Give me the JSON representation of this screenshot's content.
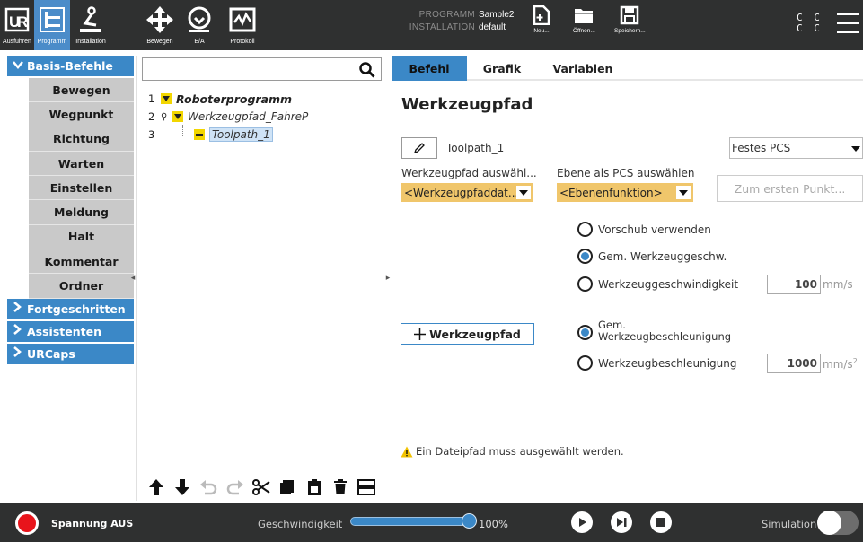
{
  "topbar": {
    "nav": [
      {
        "label": "Ausführen",
        "icon": "ur-logo-icon"
      },
      {
        "label": "Programm",
        "icon": "program-tree-icon",
        "active": true
      },
      {
        "label": "Installation",
        "icon": "installation-icon"
      },
      {
        "label": "Bewegen",
        "icon": "move-arrows-icon"
      },
      {
        "label": "E/A",
        "icon": "io-icon"
      },
      {
        "label": "Protokoll",
        "icon": "log-icon"
      }
    ],
    "program_key": "PROGRAMM",
    "program_value": "Sample2",
    "installation_key": "INSTALLATION",
    "installation_value": "default",
    "file_buttons": [
      {
        "label": "Neu...",
        "icon": "new-file-icon"
      },
      {
        "label": "Öffnen...",
        "icon": "folder-icon"
      },
      {
        "label": "Speichern...",
        "icon": "save-icon"
      }
    ],
    "cc": [
      "C C",
      "C C"
    ],
    "accent": "#4b8cc9",
    "background": "#2f3030"
  },
  "left_panel": {
    "basic_header": "Basis-Befehle",
    "basic_items": [
      "Bewegen",
      "Wegpunkt",
      "Richtung",
      "Warten",
      "Einstellen",
      "Meldung",
      "Halt",
      "Kommentar",
      "Ordner"
    ],
    "advanced": "Fortgeschritten",
    "wizards": "Assistenten",
    "urcaps": "URCaps"
  },
  "tree": {
    "search_placeholder": "",
    "rows": [
      {
        "num": "1",
        "label": "Roboterprogramm"
      },
      {
        "num": "2",
        "label": "Werkzeugpfad_FahreP"
      },
      {
        "num": "3",
        "label": "Toolpath_1"
      }
    ]
  },
  "main": {
    "tabs": [
      "Befehl",
      "Grafik",
      "Variablen"
    ],
    "title": "Werkzeugpfad",
    "toolpath_name": "Toolpath_1",
    "pcs_select": "Festes PCS",
    "select_path_label": "Werkzeugpfad auswähl...",
    "select_path_value": "<Werkzeugpfaddat...",
    "select_plane_label": "Ebene als PCS auswählen",
    "select_plane_value": "<Ebenenfunktion>",
    "first_point_button": "Zum ersten Punkt...",
    "radio_feed": "Vorschub verwenden",
    "radio_common_speed": "Gem. Werkzeuggeschw.",
    "radio_tool_speed": "Werkzeuggeschwindigkeit",
    "speed_value": "100",
    "speed_unit": "mm/s",
    "add_toolpath_button": "Werkzeugpfad",
    "radio_common_accel_line1": "Gem.",
    "radio_common_accel_line2": "Werkzeugbeschleunigung",
    "radio_tool_accel": "Werkzeugbeschleunigung",
    "accel_value": "1000",
    "accel_unit": "mm/s",
    "accel_unit_exp": "2",
    "warning": "Ein Dateipfad muss ausgewählt werden."
  },
  "bottombar": {
    "power_label": "Spannung AUS",
    "speed_label": "Geschwindigkeit",
    "speed_value": "100%",
    "speed_fraction": 1.0,
    "sim_label": "Simulation"
  }
}
